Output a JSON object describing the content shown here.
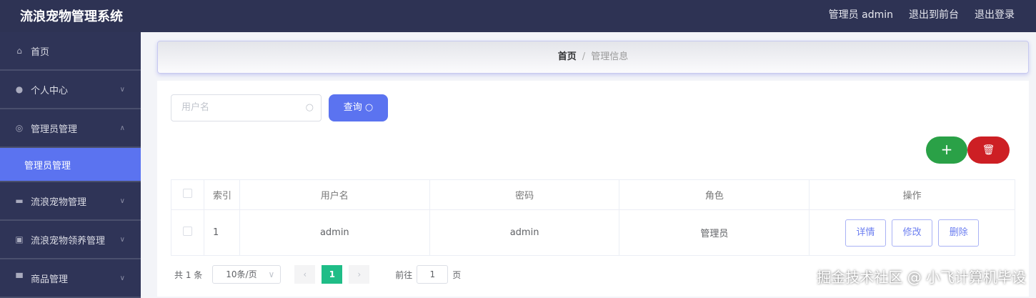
{
  "header": {
    "title": "流浪宠物管理系统",
    "user": "管理员 admin",
    "to_front": "退出到前台",
    "logout": "退出登录"
  },
  "sidebar": {
    "items": [
      {
        "label": "首页",
        "icon": "home-icon"
      },
      {
        "label": "个人中心",
        "icon": "user-icon"
      },
      {
        "label": "管理员管理",
        "icon": "lifebuoy-icon"
      },
      {
        "label": "管理员管理",
        "icon": ""
      },
      {
        "label": "流浪宠物管理",
        "icon": "chat-icon"
      },
      {
        "label": "流浪宠物领养管理",
        "icon": "clipboard-icon"
      },
      {
        "label": "商品管理",
        "icon": "monitor-icon"
      }
    ]
  },
  "breadcrumb": {
    "home": "首页",
    "sep": "/",
    "current": "管理信息"
  },
  "search": {
    "placeholder": "用户名",
    "button": "查询"
  },
  "actions": {
    "add": "+"
  },
  "table": {
    "headers": [
      "索引",
      "用户名",
      "密码",
      "角色",
      "操作"
    ],
    "rows": [
      {
        "index": "1",
        "username": "admin",
        "password": "admin",
        "role": "管理员"
      }
    ],
    "row_actions": [
      "详情",
      "修改",
      "删除"
    ]
  },
  "pagination": {
    "total": "共 1 条",
    "page_size": "10条/页",
    "current": "1",
    "goto_label": "前往",
    "goto_value": "1",
    "page_suffix": "页"
  },
  "watermark": "掘金技术社区 @ 小飞计算机毕设"
}
